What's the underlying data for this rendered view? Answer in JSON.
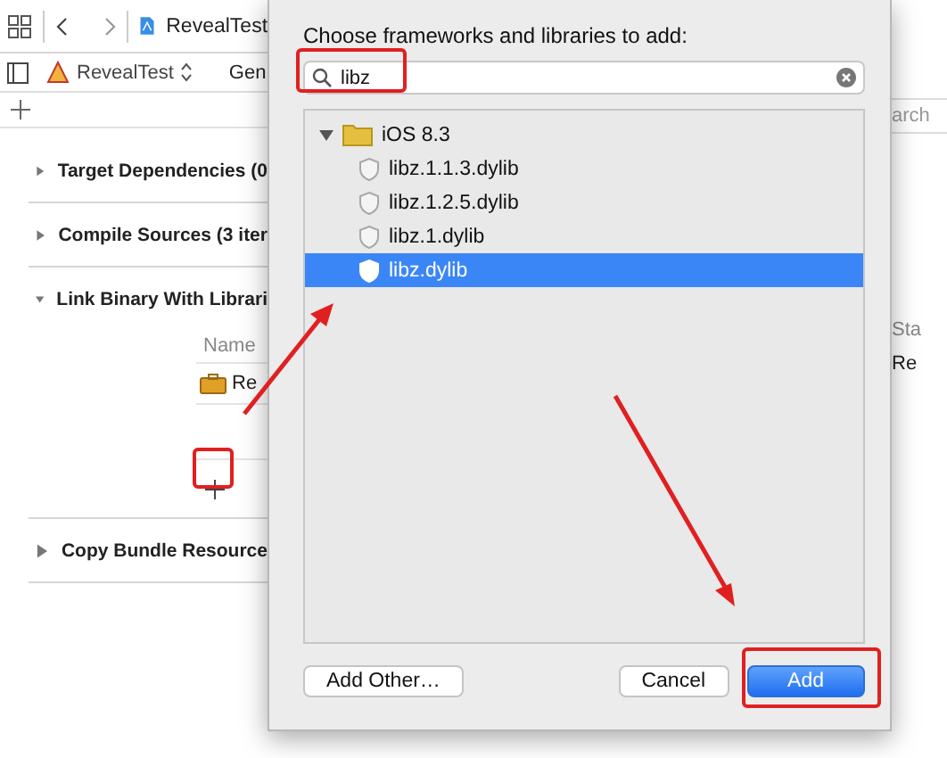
{
  "toolbar": {
    "file_tab": "RevealTest"
  },
  "editor_bar": {
    "target": "RevealTest",
    "tab": "Gen"
  },
  "phases": [
    {
      "title": "Target Dependencies (0",
      "expanded": false
    },
    {
      "title": "Compile Sources (3 iter",
      "expanded": false
    },
    {
      "title": "Link Binary With Librari",
      "expanded": true,
      "table": {
        "column_1": "Name",
        "rows": [
          "Re"
        ]
      }
    },
    {
      "title": "Copy Bundle Resource",
      "expanded": false
    }
  ],
  "right_strip": {
    "search_placeholder": "arch",
    "column": "Sta",
    "cell": "Re"
  },
  "dialog": {
    "title": "Choose frameworks and libraries to add:",
    "search": {
      "value": "libz"
    },
    "tree": [
      {
        "label": "iOS 8.3",
        "expanded": true,
        "children": [
          {
            "label": "libz.1.1.3.dylib",
            "selected": false
          },
          {
            "label": "libz.1.2.5.dylib",
            "selected": false
          },
          {
            "label": "libz.1.dylib",
            "selected": false
          },
          {
            "label": "libz.dylib",
            "selected": true
          }
        ]
      }
    ],
    "buttons": [
      {
        "label": "Add Other…",
        "kind": "secondary"
      },
      {
        "label": "Cancel",
        "kind": "secondary"
      },
      {
        "label": "Add",
        "kind": "default"
      }
    ]
  }
}
